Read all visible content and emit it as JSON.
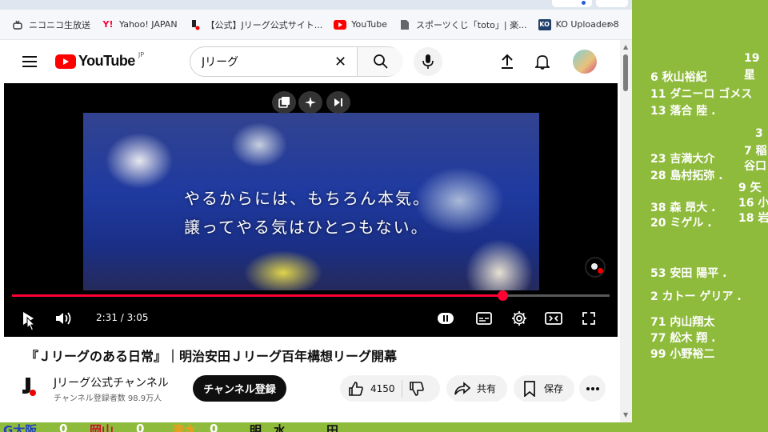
{
  "bookmarks": [
    {
      "icon": "niconico-icon",
      "label": "ニコニコ生放送"
    },
    {
      "icon": "yahoo-icon",
      "label": "Yahoo! JAPAN"
    },
    {
      "icon": "jleague-icon",
      "label": "【公式】Jリーグ公式サイト..."
    },
    {
      "icon": "youtube-icon",
      "label": "YouTube"
    },
    {
      "icon": "page-icon",
      "label": "スポーツくじ「toto」| 楽..."
    },
    {
      "icon": "ko-icon",
      "label": "KO Uploader 8"
    }
  ],
  "bookmarks_more": "»",
  "header": {
    "logo_text": "YouTube",
    "region": "JP",
    "search_value": "Jリーグ"
  },
  "video": {
    "caption_line1": "やるからには、もちろん本気。",
    "caption_line2": "譲ってやる気はひとつもない。",
    "time": "2:31 / 3:05",
    "progress": 0.82
  },
  "title": "『Ｊリーグのある日常』｜明治安田Ｊリーグ百年構想リーグ開幕",
  "channel": {
    "name": "Jリーグ公式チャンネル",
    "subscribers": "チャンネル登録者数 98.9万人",
    "subscribe_label": "チャンネル登録"
  },
  "actions": {
    "like_count": "4150",
    "share_label": "共有",
    "save_label": "保存"
  },
  "bottom_strip": [
    "G大阪",
    "0",
    "岡山",
    "0",
    "清水",
    "0",
    "明",
    "水",
    "田"
  ],
  "roster_col1": [
    "6 秋山裕紀",
    "11 ダニーロ ゴメス",
    "13 落合 陸 .",
    "23 吉満大介",
    "28 島村拓弥 .",
    "38 森 昂大 .",
    "20 ミゲル .",
    "53 安田 陽平 .",
    "2 カトー ゲリア .",
    "71 内山翔太",
    "77 舩木 翔 .",
    "99 小野裕二"
  ],
  "roster_col2": [
    "19",
    "星",
    "3",
    "7 稲",
    "谷口",
    "9 矢",
    "16 小",
    "18 岩"
  ],
  "colors": {
    "youtube_red": "#ff0000",
    "progress_red": "#ff0033",
    "roster_bg": "#8fbb3c"
  }
}
